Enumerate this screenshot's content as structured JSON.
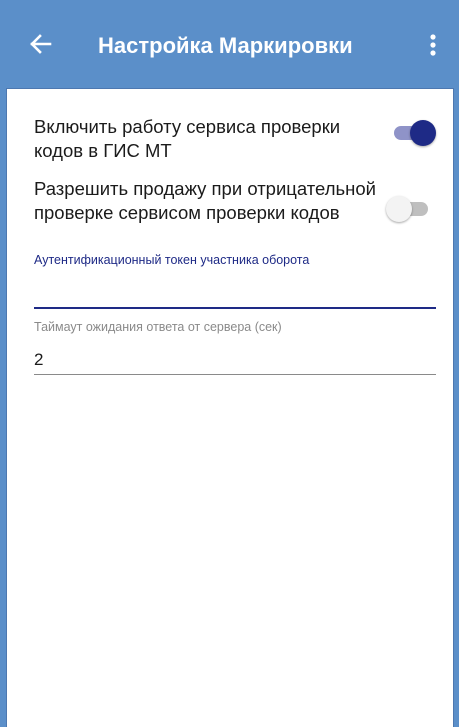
{
  "appbar": {
    "title": "Настройка Маркировки",
    "back_icon": "arrow-left-icon",
    "menu_icon": "more-vertical-icon"
  },
  "settings": {
    "enable_service": {
      "label": "Включить работу сервиса проверки кодов в ГИС МТ",
      "checked": true
    },
    "allow_sale_on_negative": {
      "label": "Разрешить продажу при отрицательной проверке сервисом проверки кодов",
      "checked": false
    }
  },
  "token_field": {
    "label": "Аутентификационный токен участника оборота",
    "value": ""
  },
  "timeout_field": {
    "label": "Таймаут ожидания ответа от сервера (сек)",
    "value": "2"
  },
  "colors": {
    "appbar": "#5b8fc9",
    "accent": "#1e2a86",
    "switch_on_track": "#8f93c8",
    "switch_off_track": "#bfbfbf"
  }
}
